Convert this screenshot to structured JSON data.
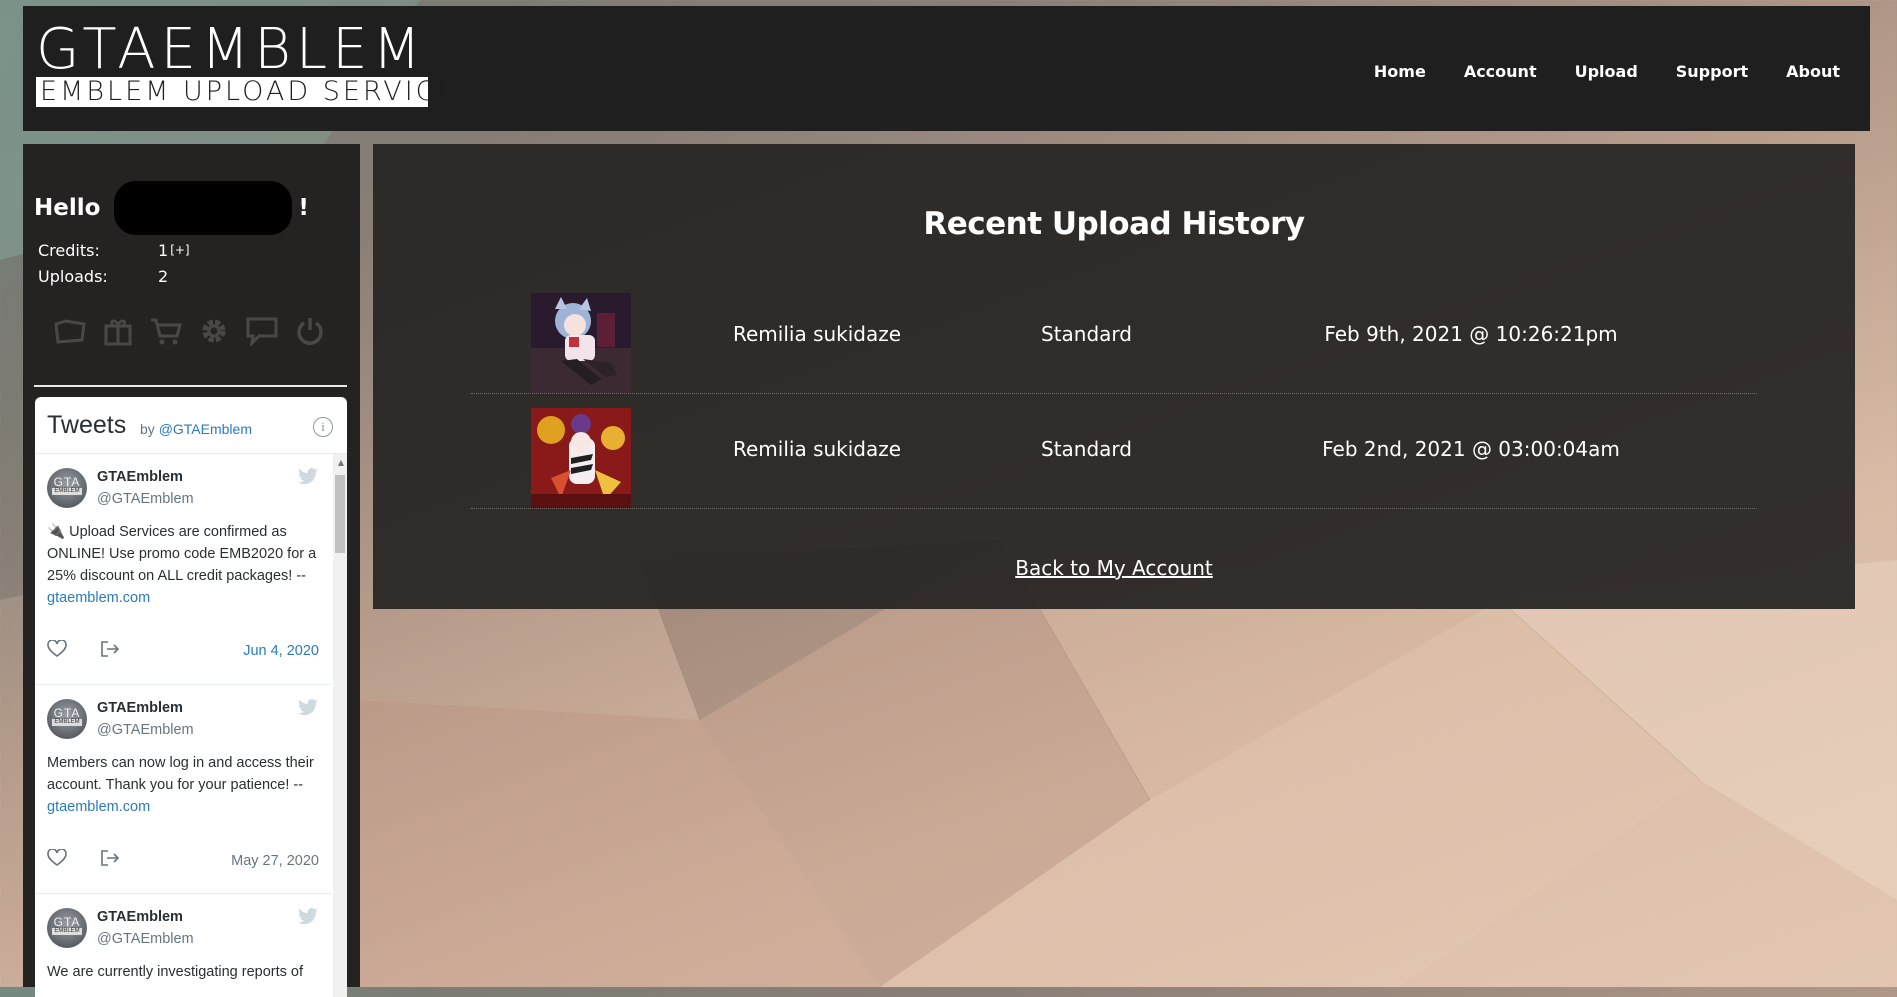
{
  "header": {
    "logo_top": "GTAEMBLEM",
    "logo_bottom": "EMBLEM UPLOAD SERVICE",
    "nav": [
      "Home",
      "Account",
      "Upload",
      "Support",
      "About"
    ]
  },
  "sidebar": {
    "hello_prefix": "Hello",
    "hello_suffix": "!",
    "credits_label": "Credits:",
    "credits_value": "1",
    "credits_plus": "[+]",
    "uploads_label": "Uploads:",
    "uploads_value": "2",
    "icons": [
      "folder-icon",
      "gift-icon",
      "cart-icon",
      "gear-icon",
      "chat-icon",
      "power-icon"
    ]
  },
  "twitter": {
    "title": "Tweets",
    "by": "by",
    "handle_link": "@GTAEmblem",
    "tweets": [
      {
        "name": "GTAEmblem",
        "handle": "@GTAEmblem",
        "emoji": "🔌",
        "text": "Upload Services are confirmed as ONLINE! Use promo code EMB2020 for a 25% discount on ALL credit packages! --",
        "link": "gtaemblem.com",
        "date": "Jun 4, 2020"
      },
      {
        "name": "GTAEmblem",
        "handle": "@GTAEmblem",
        "text": "Members can now log in and access their account. Thank you for your patience! --",
        "link": "gtaemblem.com",
        "date": "May 27, 2020"
      },
      {
        "name": "GTAEmblem",
        "handle": "@GTAEmblem",
        "text": "We are currently investigating reports of"
      }
    ]
  },
  "main": {
    "title": "Recent Upload History",
    "uploads": [
      {
        "name": "Remilia sukidaze",
        "type": "Standard",
        "date": "Feb 9th, 2021 @ 10:26:21pm"
      },
      {
        "name": "Remilia sukidaze",
        "type": "Standard",
        "date": "Feb 2nd, 2021 @ 03:00:04am"
      }
    ],
    "back_link": "Back to My Account"
  },
  "colors": {
    "header_bg": "#1f1f1f",
    "panel_bg": "#262422",
    "twitter_link": "#2b7bb9"
  }
}
